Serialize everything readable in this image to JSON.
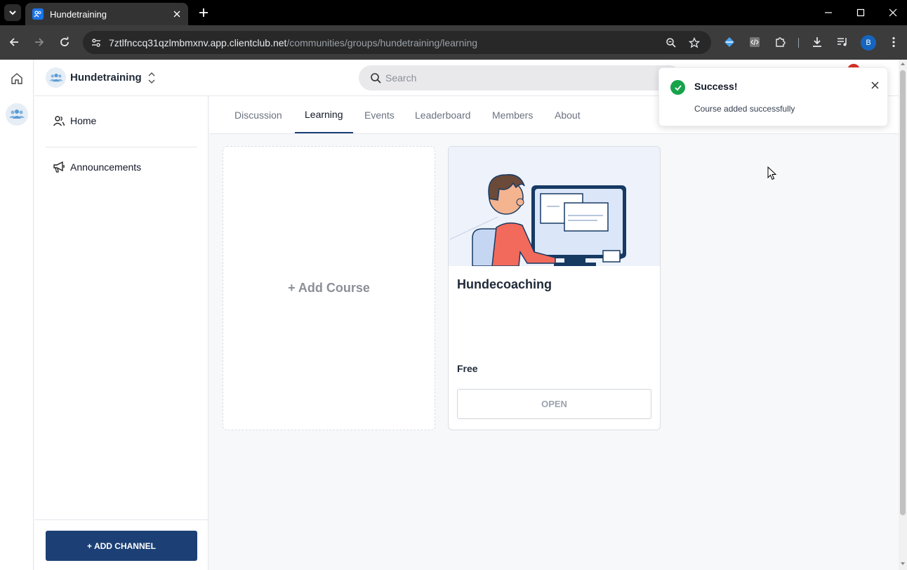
{
  "browser": {
    "tab_title": "Hundetraining",
    "url_host": "7ztlfnccq31qzlmbmxnv.app.clientclub.net",
    "url_path": "/communities/groups/hundetraining/learning",
    "profile_initial": "B"
  },
  "header": {
    "community_name": "Hundetraining",
    "search_placeholder": "Search"
  },
  "sidebar": {
    "items": [
      {
        "label": "Home",
        "icon": "users-icon"
      },
      {
        "label": "Announcements",
        "icon": "megaphone-icon"
      }
    ],
    "add_channel_label": "+ ADD CHANNEL"
  },
  "tabs": [
    {
      "label": "Discussion",
      "active": false
    },
    {
      "label": "Learning",
      "active": true
    },
    {
      "label": "Events",
      "active": false
    },
    {
      "label": "Leaderboard",
      "active": false
    },
    {
      "label": "Members",
      "active": false
    },
    {
      "label": "About",
      "active": false
    }
  ],
  "learning": {
    "add_course_label": "+ Add Course",
    "courses": [
      {
        "title": "Hundecoaching",
        "price": "Free",
        "action_label": "OPEN"
      }
    ]
  },
  "toast": {
    "title": "Success!",
    "message": "Course added successfully"
  },
  "colors": {
    "primary": "#1c4075",
    "success": "#16a34a",
    "notification": "#d93025"
  }
}
